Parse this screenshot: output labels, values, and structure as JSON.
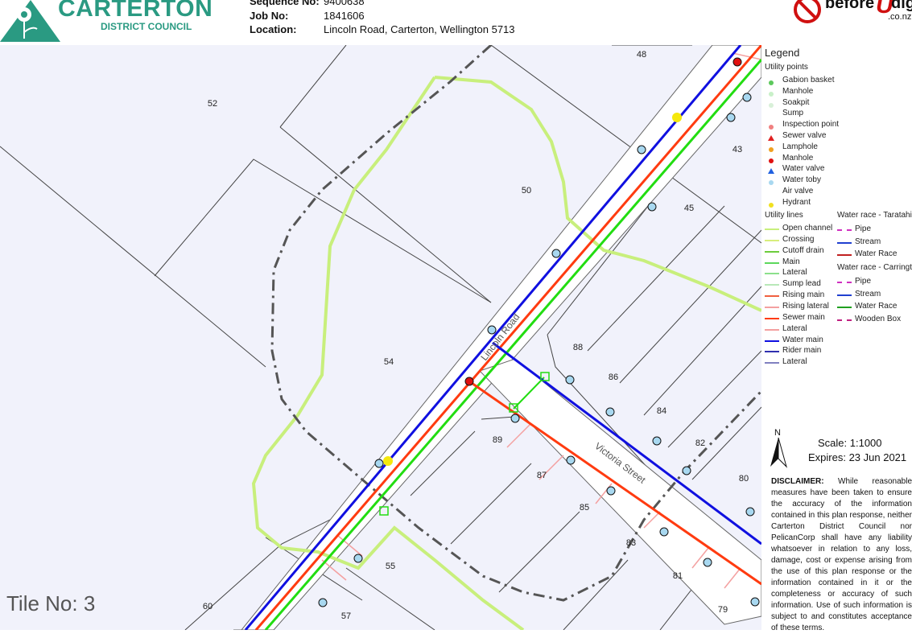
{
  "header": {
    "org_name": "CARTERTON",
    "org_sub": "DISTRICT COUNCIL",
    "sequence_label": "Sequence No:",
    "sequence_value": "9400638",
    "job_label": "Job No:",
    "job_value": "1841606",
    "location_label": "Location:",
    "location_value": "Lincoln Road, Carterton, Wellington  5713",
    "service_logo": "beforeUdig .co.nz"
  },
  "map": {
    "tile": "Tile No: 3",
    "road_labels": [
      "Lincoln Road",
      "Victoria Street"
    ],
    "parcel_numbers": [
      "48",
      "52",
      "43",
      "50",
      "45",
      "88",
      "86",
      "54",
      "84",
      "89",
      "82",
      "87",
      "80",
      "85",
      "83",
      "55",
      "81",
      "60",
      "79",
      "57"
    ],
    "colors": {
      "water_main": "#1010e0",
      "sewer_main": "#ff3b10",
      "cutoff_drain": "#22dd11",
      "open_channel": "#c8ef7c",
      "lateral": "#f4a0a0",
      "boundary": "#555555",
      "background": "#f1f2fb"
    }
  },
  "legend": {
    "title": "Legend",
    "points_heading": "Utility points",
    "points": [
      {
        "label": "Gabion basket",
        "symbol": "half-circle",
        "color": "#5cc85c"
      },
      {
        "label": "Manhole",
        "symbol": "circle",
        "color": "#c8f0c8"
      },
      {
        "label": "Soakpit",
        "symbol": "circle",
        "color": "#d8f0d8"
      },
      {
        "label": "Sump",
        "symbol": "none",
        "color": ""
      },
      {
        "label": "Inspection point",
        "symbol": "circle",
        "color": "#f08080"
      },
      {
        "label": "Sewer valve",
        "symbol": "triangle",
        "color": "#e02020"
      },
      {
        "label": "Lamphole",
        "symbol": "circle",
        "color": "#f0a020"
      },
      {
        "label": "Manhole",
        "symbol": "circle",
        "color": "#e01010"
      },
      {
        "label": "Water valve",
        "symbol": "triangle",
        "color": "#2060e0"
      },
      {
        "label": "Water toby",
        "symbol": "circle",
        "color": "#a8d8f0"
      },
      {
        "label": "Air valve",
        "symbol": "none",
        "color": ""
      },
      {
        "label": "Hydrant",
        "symbol": "circle",
        "color": "#f0e020"
      }
    ],
    "lines_heading": "Utility lines",
    "lines": [
      {
        "label": "Open channel",
        "color": "#c8ef7c"
      },
      {
        "label": "Crossing",
        "color": "#d8ee7c"
      },
      {
        "label": "Cutoff drain",
        "color": "#6ccc3c"
      },
      {
        "label": "Main",
        "color": "#5cd85c"
      },
      {
        "label": "Lateral",
        "color": "#8ce08c"
      },
      {
        "label": "Sump lead",
        "color": "#b8e8b8"
      },
      {
        "label": "Rising main",
        "color": "#f06040"
      },
      {
        "label": "Rising lateral",
        "color": "#f4a0a0"
      },
      {
        "label": "Sewer main",
        "color": "#ff3b10"
      },
      {
        "label": "Lateral",
        "color": "#f4a0a0"
      },
      {
        "label": "Water main",
        "color": "#1010e0"
      },
      {
        "label": "Rider main",
        "color": "#3030b0"
      },
      {
        "label": "Lateral",
        "color": "#8080c0"
      }
    ],
    "taratahi_heading": "Water race - Taratahi",
    "taratahi": [
      {
        "label": "Pipe",
        "color": "#d030c0",
        "dashed": true
      },
      {
        "label": "Stream",
        "color": "#2040d0",
        "dashed": false
      },
      {
        "label": "Water Race",
        "color": "#c02020",
        "dashed": false
      }
    ],
    "carrington_heading": "Water race - Carrington",
    "carrington": [
      {
        "label": "Pipe",
        "color": "#d030c0",
        "dashed": true
      },
      {
        "label": "Stream",
        "color": "#2040d0",
        "dashed": false
      },
      {
        "label": "Water Race",
        "color": "#20a020",
        "dashed": false
      },
      {
        "label": "Wooden Box",
        "color": "#c02080",
        "dashed": true
      }
    ]
  },
  "footer": {
    "north": "N",
    "scale": "Scale:  1:1000",
    "expires": "Expires:  23 Jun 2021",
    "disclaimer_title": "DISCLAIMER:",
    "disclaimer": "While reasonable measures have been taken to ensure the accuracy of the information contained in this plan response, neither Carterton District Council nor PelicanCorp shall have any liability whatsoever in relation to any loss, damage, cost or expense arising from the use of this plan response or the information contained in it or the completeness or accuracy of such information. Use of such information is subject to and constitutes acceptance of these terms."
  }
}
